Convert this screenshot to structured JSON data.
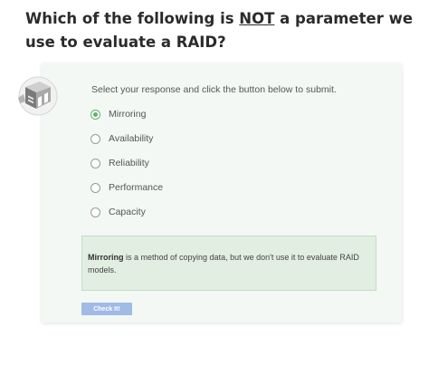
{
  "question": {
    "prefix": "Which of the following is ",
    "emphasis": "NOT",
    "suffix": " a parameter we use to evaluate a RAID?"
  },
  "instructions": "Select your response and click the button below to submit.",
  "options": [
    {
      "label": "Mirroring",
      "selected": true
    },
    {
      "label": "Availability",
      "selected": false
    },
    {
      "label": "Reliability",
      "selected": false
    },
    {
      "label": "Performance",
      "selected": false
    },
    {
      "label": "Capacity",
      "selected": false
    }
  ],
  "feedback": {
    "bold": "Mirroring",
    "text": " is a method of copying data, but we don't use it to evaluate RAID models."
  },
  "check_button": "Check It!",
  "colors": {
    "accent_green": "#5cb46a",
    "button_blue": "#9fbbe6",
    "feedback_bg": "#e1eee1"
  },
  "icons": [
    "server-rack-icon"
  ]
}
